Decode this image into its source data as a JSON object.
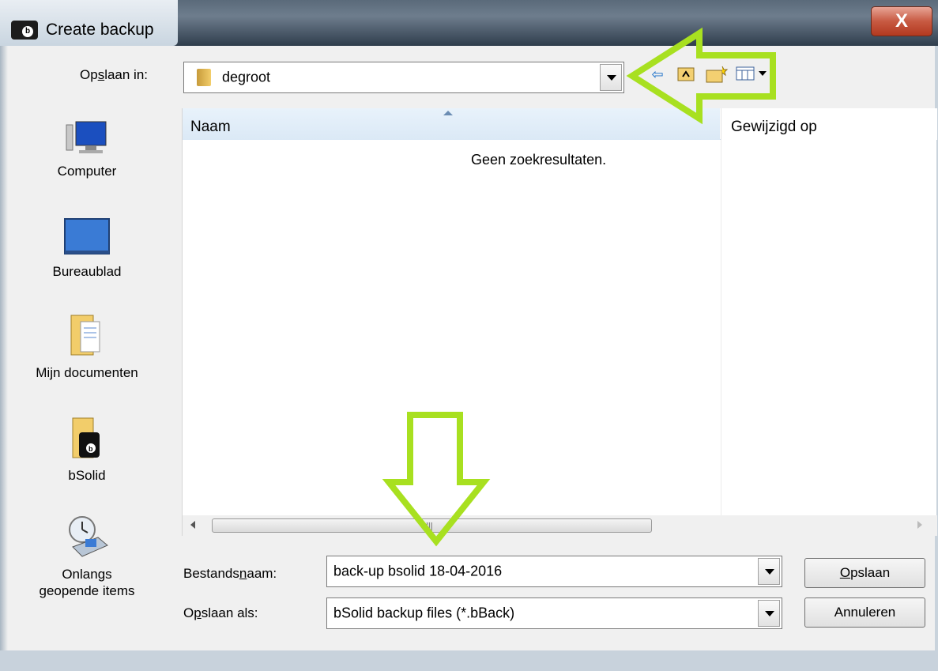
{
  "window": {
    "title": "Create backup",
    "close_label": "X"
  },
  "save_in": {
    "label_pre": "Op",
    "label_mnemonic": "s",
    "label_post": "laan in:",
    "value": "degroot"
  },
  "toolbar": {
    "back_icon": "back-arrow-icon",
    "up_icon": "up-folder-icon",
    "new_folder_icon": "new-folder-icon",
    "view_icon": "view-menu-icon"
  },
  "places": [
    {
      "label": "Computer",
      "icon": "computer-icon"
    },
    {
      "label": "Bureaublad",
      "icon": "desktop-icon"
    },
    {
      "label": "Mijn documenten",
      "icon": "documents-icon"
    },
    {
      "label": "bSolid",
      "icon": "bsolid-folder-icon"
    },
    {
      "label_line1": "Onlangs",
      "label_line2": "geopende items",
      "icon": "recent-items-icon"
    }
  ],
  "filelist": {
    "columns": [
      "Naam",
      "Gewijzigd op"
    ],
    "empty_message": "Geen zoekresultaten."
  },
  "filename": {
    "label_pre": "Bestands",
    "label_mnemonic": "n",
    "label_post": "aam:",
    "value": "back-up bsolid 18-04-2016"
  },
  "filetype": {
    "label_pre": "O",
    "label_mnemonic": "p",
    "label_post": "slaan als:",
    "value": "bSolid backup files (*.bBack)"
  },
  "buttons": {
    "save_mnemonic": "O",
    "save_rest": "pslaan",
    "cancel": "Annuleren"
  },
  "colors": {
    "annotation_arrow": "#a8e020"
  }
}
